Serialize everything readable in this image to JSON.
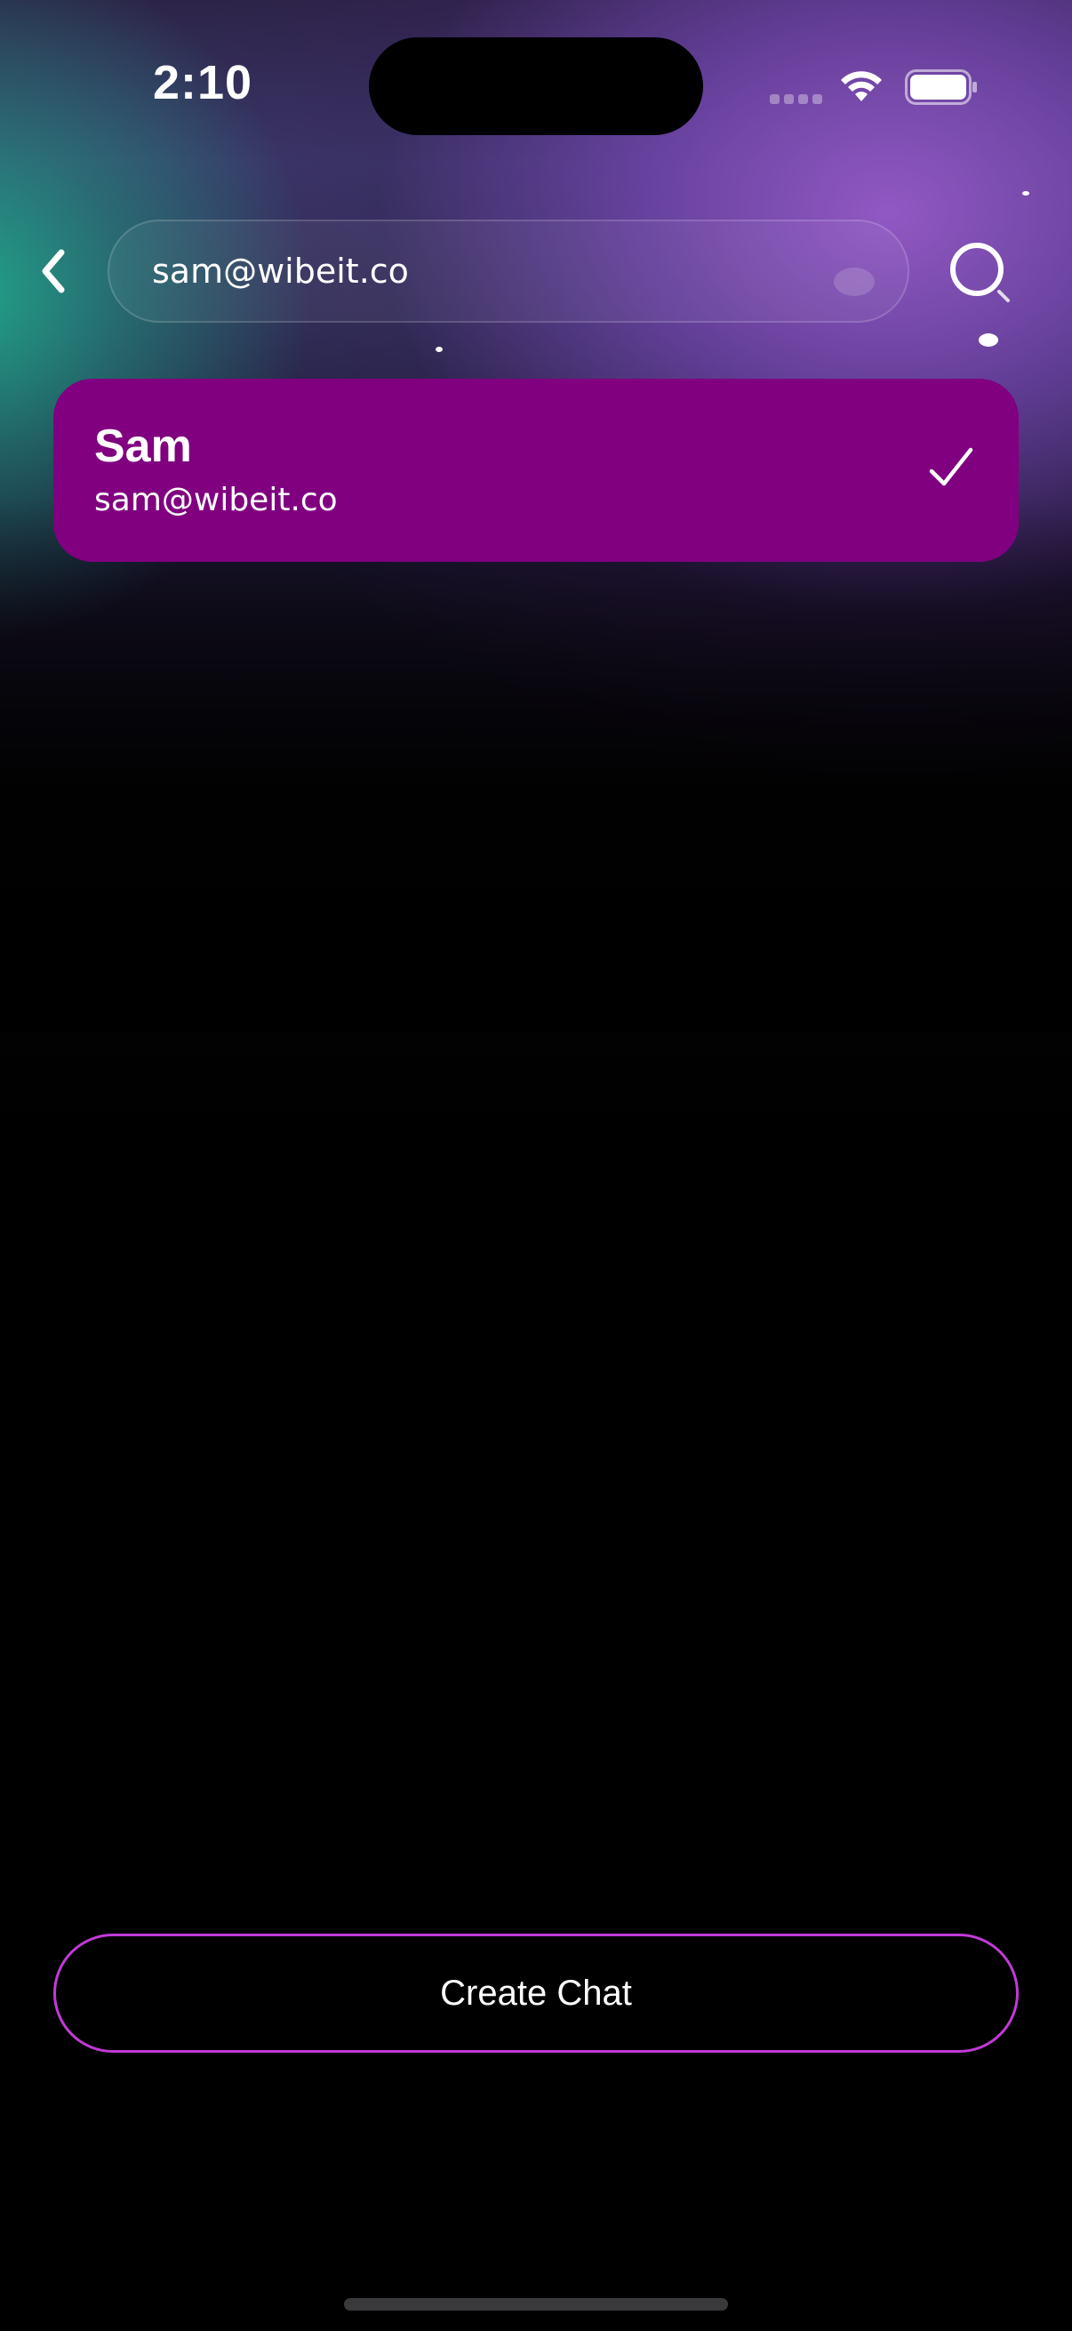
{
  "status_bar": {
    "time": "2:10"
  },
  "search": {
    "value": "sam@wibeit.co",
    "back_icon": "chevron-left-icon",
    "search_icon": "search-icon"
  },
  "results": [
    {
      "name": "Sam",
      "email": "sam@wibeit.co",
      "selected": true,
      "selected_icon": "checkmark-icon"
    }
  ],
  "actions": {
    "create_chat_label": "Create Chat"
  },
  "colors": {
    "card_background": "#800080",
    "button_border": "#c13ad6",
    "accent_teal": "#20aa8c",
    "accent_purple": "#9650c8"
  }
}
